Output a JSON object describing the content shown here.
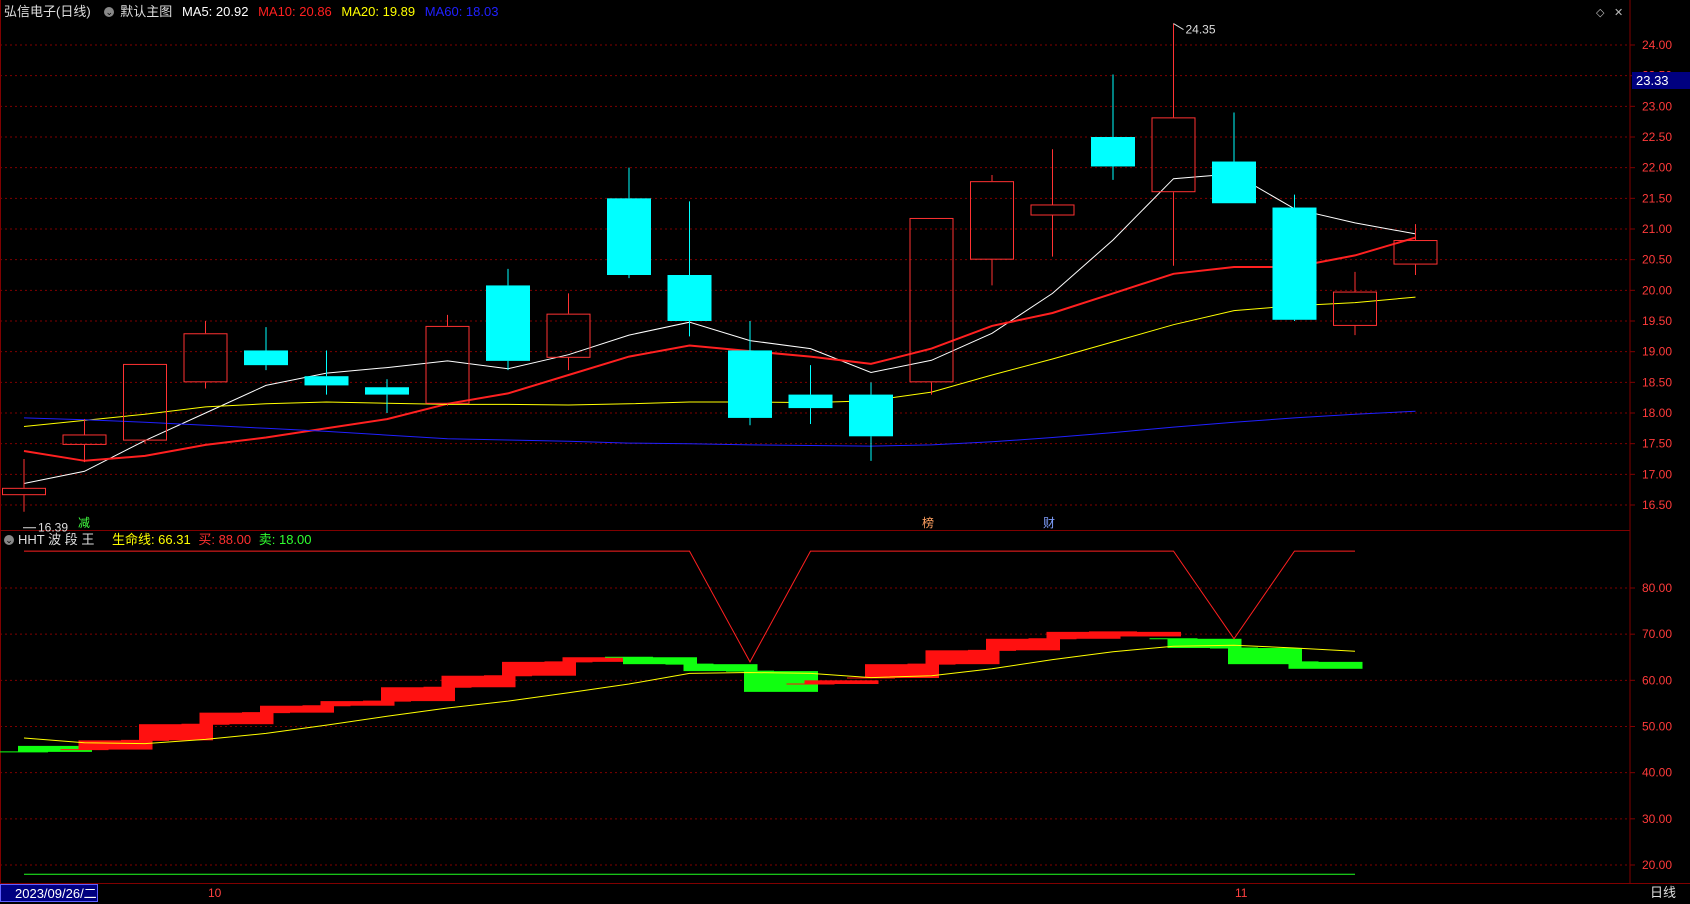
{
  "header": {
    "stock": "弘信电子(日线)",
    "theme": "默认主图",
    "ma5_label": "MA5: 20.92",
    "ma10_label": "MA10: 20.86",
    "ma20_label": "MA20: 19.89",
    "ma60_label": "MA60: 18.03"
  },
  "indicator": {
    "name": "HHT 波 段 王",
    "life_label": "生命线: 66.31",
    "buy_label": "买: 88.00",
    "sell_label": "卖: 18.00"
  },
  "footer": {
    "date": "2023/09/26/二",
    "period": "日线",
    "month_labels": [
      "10",
      "11"
    ]
  },
  "price_box": "23.33",
  "events": [
    "减",
    "榜",
    "财"
  ],
  "colors": {
    "up": "#ff3232",
    "down": "#00ffff",
    "ma5": "#ffffff",
    "ma10": "#ff2020",
    "ma20": "#ffff00",
    "ma60": "#2020ff",
    "bg": "#000000",
    "grid": "#800000"
  },
  "chart_data": [
    {
      "type": "candlestick",
      "title": "弘信电子(日线)",
      "y_ticks": [
        "24.00",
        "23.50",
        "23.00",
        "22.50",
        "22.00",
        "21.50",
        "21.00",
        "20.50",
        "20.00",
        "19.50",
        "19.00",
        "18.50",
        "18.00",
        "17.50",
        "17.00",
        "16.50"
      ],
      "ylim": [
        16.2,
        24.5
      ],
      "high_annotation": "24.35",
      "low_annotation": "16.39",
      "candles": [
        {
          "o": 16.66,
          "c": 16.78,
          "h": 17.25,
          "l": 16.39
        },
        {
          "o": 17.48,
          "c": 17.65,
          "h": 17.9,
          "l": 17.2
        },
        {
          "o": 17.55,
          "c": 18.8,
          "h": 18.8,
          "l": 17.5
        },
        {
          "o": 18.5,
          "c": 19.3,
          "h": 19.5,
          "l": 18.4
        },
        {
          "o": 19.02,
          "c": 18.78,
          "h": 19.4,
          "l": 18.7
        },
        {
          "o": 18.6,
          "c": 18.45,
          "h": 19.02,
          "l": 18.3
        },
        {
          "o": 18.42,
          "c": 18.3,
          "h": 18.55,
          "l": 18.0
        },
        {
          "o": 18.15,
          "c": 19.42,
          "h": 19.6,
          "l": 18.12
        },
        {
          "o": 20.08,
          "c": 18.85,
          "h": 20.35,
          "l": 18.7
        },
        {
          "o": 18.9,
          "c": 19.62,
          "h": 19.95,
          "l": 18.7
        },
        {
          "o": 21.5,
          "c": 20.25,
          "h": 22.0,
          "l": 20.2
        },
        {
          "o": 20.25,
          "c": 19.5,
          "h": 21.45,
          "l": 19.25
        },
        {
          "o": 19.02,
          "c": 17.92,
          "h": 19.5,
          "l": 17.8
        },
        {
          "o": 18.3,
          "c": 18.08,
          "h": 18.78,
          "l": 17.82
        },
        {
          "o": 18.3,
          "c": 17.62,
          "h": 18.5,
          "l": 17.22
        },
        {
          "o": 18.5,
          "c": 21.18,
          "h": 21.18,
          "l": 18.3
        },
        {
          "o": 20.5,
          "c": 21.78,
          "h": 21.88,
          "l": 20.08
        },
        {
          "o": 21.22,
          "c": 21.4,
          "h": 22.3,
          "l": 20.55
        },
        {
          "o": 22.5,
          "c": 22.02,
          "h": 23.52,
          "l": 21.8
        },
        {
          "o": 21.6,
          "c": 22.82,
          "h": 24.35,
          "l": 20.4
        },
        {
          "o": 22.1,
          "c": 21.42,
          "h": 22.9,
          "l": 21.42
        },
        {
          "o": 21.35,
          "c": 19.52,
          "h": 21.56,
          "l": 19.5
        },
        {
          "o": 19.42,
          "c": 19.98,
          "h": 20.3,
          "l": 19.27
        },
        {
          "o": 20.42,
          "c": 20.82,
          "h": 21.08,
          "l": 20.25
        }
      ],
      "series": [
        {
          "name": "MA5",
          "values": [
            16.85,
            17.05,
            17.55,
            18.0,
            18.45,
            18.65,
            18.74,
            18.85,
            18.72,
            18.95,
            19.27,
            19.48,
            19.18,
            19.05,
            18.66,
            18.86,
            19.3,
            19.95,
            20.82,
            21.82,
            21.9,
            21.33,
            21.1,
            20.92
          ]
        },
        {
          "name": "MA10",
          "values": [
            17.38,
            17.22,
            17.3,
            17.48,
            17.6,
            17.75,
            17.9,
            18.15,
            18.32,
            18.62,
            18.92,
            19.1,
            19.01,
            18.92,
            18.8,
            19.05,
            19.42,
            19.63,
            19.95,
            20.27,
            20.38,
            20.38,
            20.57,
            20.86
          ]
        },
        {
          "name": "MA20",
          "values": [
            17.78,
            17.88,
            17.98,
            18.1,
            18.15,
            18.18,
            18.16,
            18.14,
            18.14,
            18.13,
            18.15,
            18.18,
            18.18,
            18.17,
            18.2,
            18.34,
            18.62,
            18.88,
            19.16,
            19.44,
            19.67,
            19.75,
            19.8,
            19.89
          ]
        },
        {
          "name": "MA60",
          "values": [
            17.92,
            17.89,
            17.85,
            17.8,
            17.75,
            17.7,
            17.64,
            17.58,
            17.56,
            17.54,
            17.51,
            17.5,
            17.48,
            17.47,
            17.46,
            17.48,
            17.53,
            17.6,
            17.68,
            17.77,
            17.85,
            17.92,
            17.98,
            18.03
          ]
        }
      ]
    },
    {
      "type": "bar",
      "title": "HHT 波 段 王",
      "y_ticks": [
        "80.00",
        "70.00",
        "60.00",
        "50.00",
        "40.00",
        "30.00",
        "20.00"
      ],
      "ylim": [
        17.5,
        92
      ],
      "blocks": [
        {
          "o": 44.5,
          "c": 45.8,
          "dir": "down"
        },
        {
          "o": 45.0,
          "c": 47.0,
          "dir": "up"
        },
        {
          "o": 47.0,
          "c": 50.5,
          "dir": "up"
        },
        {
          "o": 50.5,
          "c": 53.0,
          "dir": "up"
        },
        {
          "o": 53.0,
          "c": 54.5,
          "dir": "up"
        },
        {
          "o": 54.5,
          "c": 55.5,
          "dir": "up"
        },
        {
          "o": 55.5,
          "c": 58.5,
          "dir": "up"
        },
        {
          "o": 58.5,
          "c": 61.0,
          "dir": "up"
        },
        {
          "o": 61.0,
          "c": 64.0,
          "dir": "up"
        },
        {
          "o": 64.0,
          "c": 65.0,
          "dir": "up"
        },
        {
          "o": 65.0,
          "c": 63.5,
          "dir": "down"
        },
        {
          "o": 63.5,
          "c": 62.0,
          "dir": "down"
        },
        {
          "o": 62.0,
          "c": 57.5,
          "dir": "down"
        },
        {
          "o": 59.2,
          "c": 60.0,
          "dir": "up"
        },
        {
          "o": 60.5,
          "c": 63.5,
          "dir": "up"
        },
        {
          "o": 63.5,
          "c": 66.5,
          "dir": "up"
        },
        {
          "o": 66.5,
          "c": 69.0,
          "dir": "up"
        },
        {
          "o": 69.0,
          "c": 70.5,
          "dir": "up"
        },
        {
          "o": 70.5,
          "c": 69.5,
          "dir": "up"
        },
        {
          "o": 69.0,
          "c": 67.0,
          "dir": "down"
        },
        {
          "o": 67.0,
          "c": 63.5,
          "dir": "down"
        },
        {
          "o": 64.0,
          "c": 62.5,
          "dir": "down"
        }
      ],
      "series": [
        {
          "name": "生命线",
          "values": [
            47.5,
            46.5,
            46.3,
            47.2,
            48.5,
            50.3,
            52.2,
            54.0,
            55.5,
            57.3,
            59.2,
            61.5,
            61.7,
            61.5,
            60.6,
            61.0,
            62.5,
            64.5,
            66.2,
            67.4,
            67.6,
            67.0,
            66.3
          ]
        },
        {
          "name": "买",
          "values": [
            88,
            88,
            88,
            88,
            88,
            88,
            88,
            88,
            88,
            88,
            88,
            88,
            64,
            88,
            88,
            88,
            88,
            88,
            88,
            88,
            69,
            88,
            88
          ]
        },
        {
          "name": "卖",
          "values": [
            18,
            18,
            18,
            18,
            18,
            18,
            18,
            18,
            18,
            18,
            18,
            18,
            18,
            18,
            18,
            18,
            18,
            18,
            18,
            18,
            18,
            18,
            18
          ]
        }
      ]
    }
  ]
}
